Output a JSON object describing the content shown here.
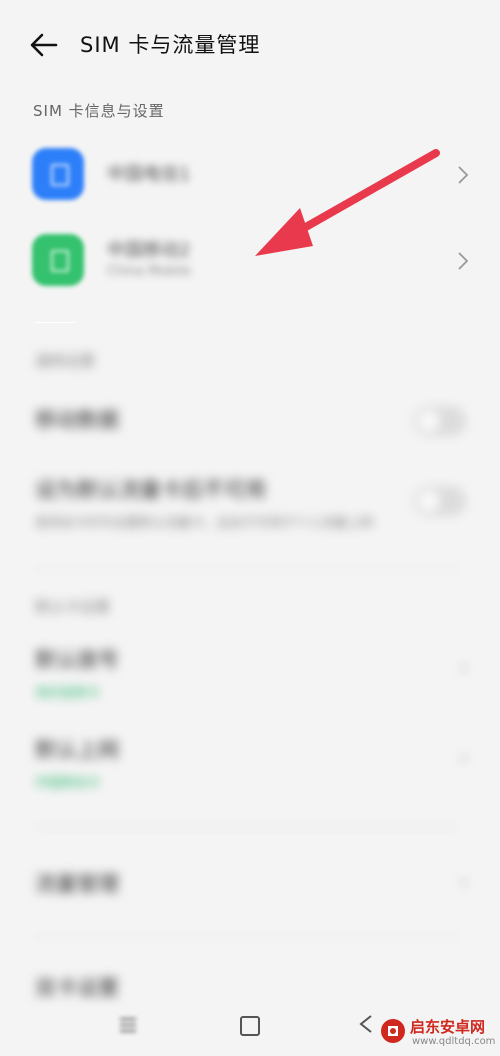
{
  "header": {
    "title": "SIM 卡与流量管理",
    "back_icon": "arrow-left-icon"
  },
  "sim_section": {
    "heading": "SIM 卡信息与设置",
    "cards": [
      {
        "name": "中国电信1",
        "subtitle": "",
        "icon": "sim-card-icon",
        "color": "#2d7ff9"
      },
      {
        "name": "中国移动2",
        "subtitle": "China Mobile",
        "icon": "sim-card-icon",
        "color": "#34c26e"
      }
    ]
  },
  "general_section": {
    "heading": "通用设置",
    "rows": [
      {
        "label": "移动数据",
        "toggle": "off"
      },
      {
        "label": "设为默认流量卡后不可用",
        "subtitle": "使用双卡时可设置默认流量卡，此处不可用于个人流量上网",
        "toggle": "off"
      }
    ]
  },
  "default_section": {
    "heading": "默认卡设置",
    "rows": [
      {
        "label": "默认拨号",
        "subtitle": "询问选择卡"
      },
      {
        "label": "默认上网",
        "subtitle": "中国移动卡"
      }
    ]
  },
  "extra_rows": [
    {
      "label": "流量管理"
    },
    {
      "label": "双卡设置"
    }
  ],
  "annotation": {
    "arrow_color": "#e8394d"
  },
  "watermark": {
    "name": "启东安卓网",
    "url": "www.qdltdq.com"
  }
}
